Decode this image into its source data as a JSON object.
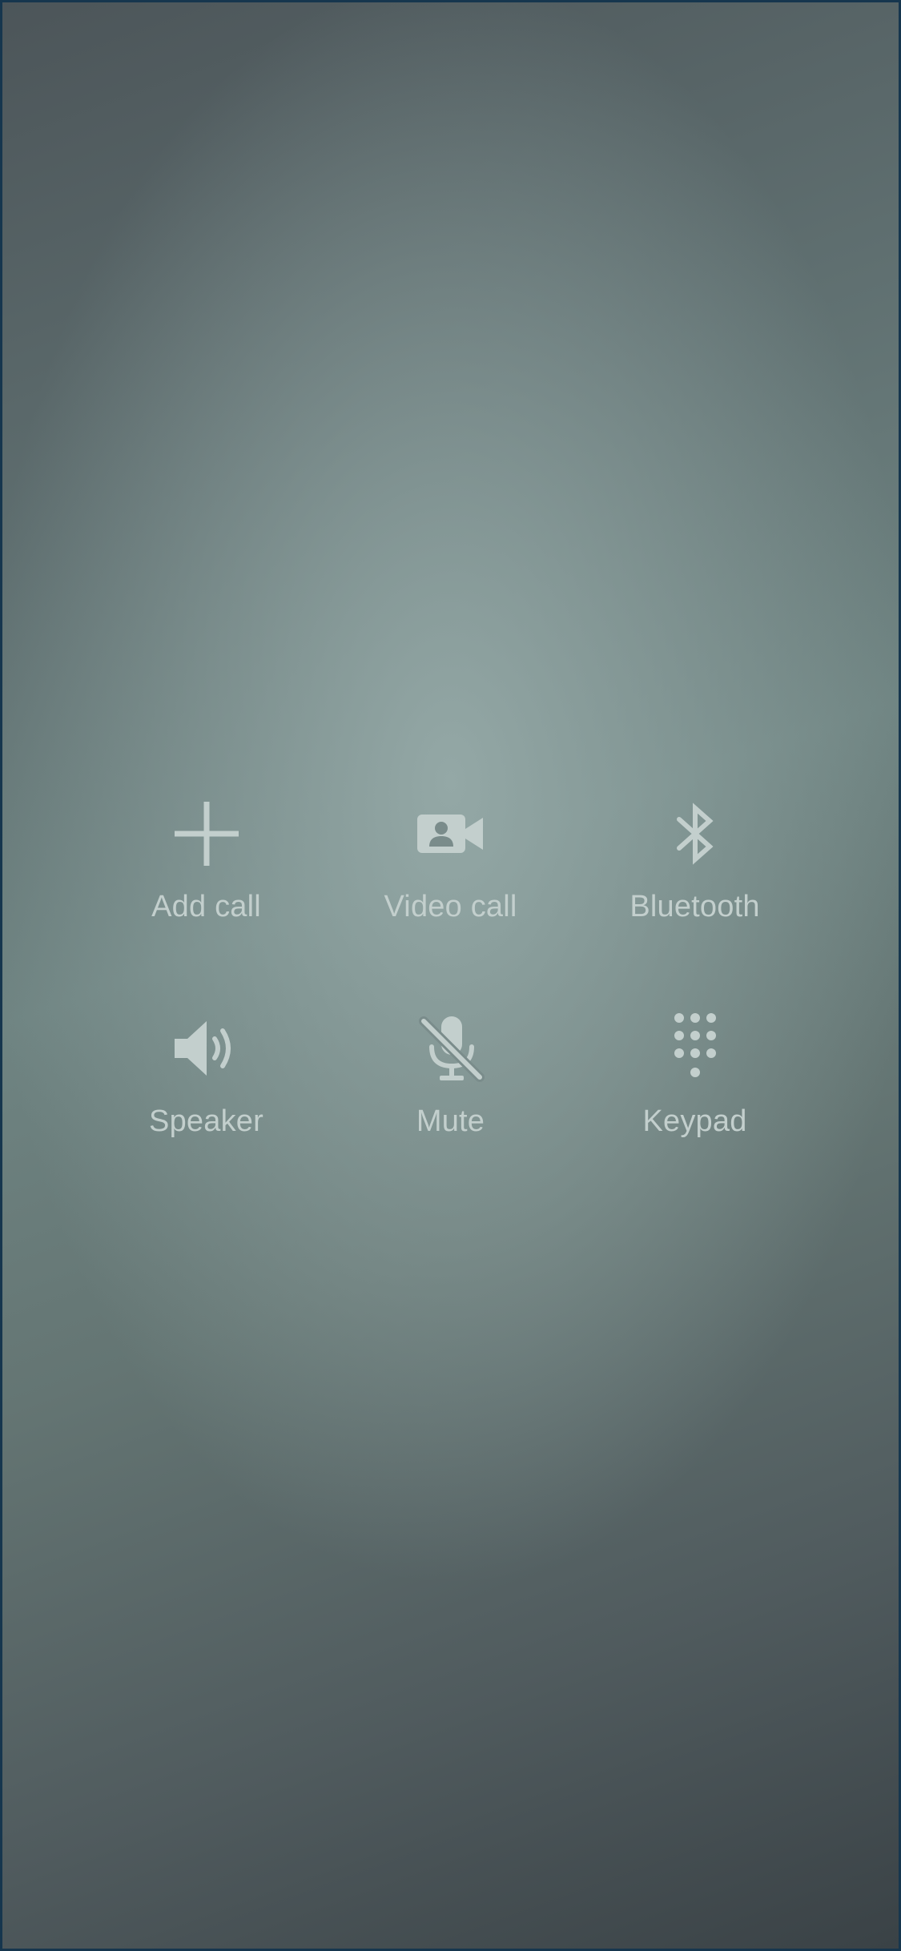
{
  "theme": {
    "icon_color": "#c3cfcd",
    "label_color": "#c3cfcd",
    "frame_border": "#16364e"
  },
  "call_controls": [
    {
      "label": "Add call",
      "icon": "plus-icon"
    },
    {
      "label": "Video call",
      "icon": "video-camera-icon"
    },
    {
      "label": "Bluetooth",
      "icon": "bluetooth-icon"
    },
    {
      "label": "Speaker",
      "icon": "speaker-icon"
    },
    {
      "label": "Mute",
      "icon": "mic-off-icon"
    },
    {
      "label": "Keypad",
      "icon": "dialpad-icon"
    }
  ]
}
